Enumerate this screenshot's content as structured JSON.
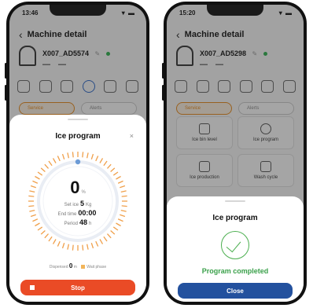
{
  "phone1": {
    "status_time": "13:46",
    "status_icons": "▾ ▬",
    "header_title": "Machine detail",
    "machine_name": "X007_AD5574",
    "tabs": [
      "Service",
      "Alerts"
    ],
    "sheet": {
      "title": "Ice program",
      "close": "×",
      "percent_value": "0",
      "percent_unit": "%",
      "set_ice_label": "Set ice",
      "set_ice_value": "5",
      "set_ice_unit": "Kg",
      "end_time_label": "End time",
      "end_time_value": "00:00",
      "period_label": "Period",
      "period_value": "48",
      "period_unit": "h",
      "dispense_label": "Dispensed",
      "dispense_value": "0",
      "dispense_unit": "m",
      "wait_label": "Wait phase",
      "stop_label": "Stop"
    }
  },
  "phone2": {
    "status_time": "15:20",
    "status_icons": "▾ ▬",
    "header_title": "Machine detail",
    "machine_name": "X007_AD5298",
    "tabs": [
      "Service",
      "Alerts"
    ],
    "tiles": [
      "Ice bin level",
      "Ice program",
      "Ice production",
      "Wash cycle"
    ],
    "sheet": {
      "title": "Ice program",
      "completed_text": "Program completed",
      "close_label": "Close"
    }
  },
  "colors": {
    "accent_orange": "#ea4b26",
    "accent_blue": "#23519e",
    "success_green": "#3aa04a",
    "dial_tick": "#f0a04b"
  },
  "icons": {
    "back": "chevron-left-icon",
    "edit": "pencil-icon",
    "close": "close-icon",
    "success": "check-circle-icon"
  }
}
